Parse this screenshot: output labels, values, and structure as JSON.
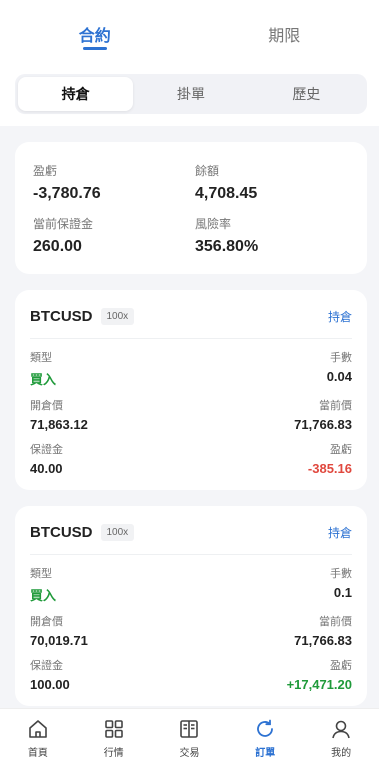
{
  "tabs": [
    {
      "label": "合約",
      "active": true
    },
    {
      "label": "期限",
      "active": false
    }
  ],
  "segments": [
    {
      "label": "持倉",
      "active": true
    },
    {
      "label": "掛單",
      "active": false
    },
    {
      "label": "歷史",
      "active": false
    }
  ],
  "summary": {
    "pnl_label": "盈虧",
    "pnl": "-3,780.76",
    "balance_label": "餘額",
    "balance": "4,708.45",
    "margin_label": "當前保證金",
    "margin": "260.00",
    "risk_label": "風險率",
    "risk": "356.80%"
  },
  "positions": [
    {
      "symbol": "BTCUSD",
      "leverage": "100x",
      "status": "持倉",
      "type_label": "類型",
      "type": "買入",
      "lots_label": "手數",
      "lots": "0.04",
      "open_label": "開倉價",
      "open": "71,863.12",
      "current_label": "當前價",
      "current": "71,766.83",
      "margin_label": "保證金",
      "margin": "40.00",
      "pnl_label": "盈虧",
      "pnl": "-385.16"
    },
    {
      "symbol": "BTCUSD",
      "leverage": "100x",
      "status": "持倉",
      "type_label": "類型",
      "type": "買入",
      "lots_label": "手數",
      "lots": "0.1",
      "open_label": "開倉價",
      "open": "70,019.71",
      "current_label": "當前價",
      "current": "71,766.83",
      "margin_label": "保證金",
      "margin": "100.00",
      "pnl_label": "盈虧",
      "pnl": "+17,471.20"
    }
  ],
  "nav": [
    {
      "label": "首頁",
      "icon": "home-icon"
    },
    {
      "label": "行情",
      "icon": "grid-icon"
    },
    {
      "label": "交易",
      "icon": "book-icon"
    },
    {
      "label": "訂單",
      "icon": "refresh-icon",
      "active": true
    },
    {
      "label": "我的",
      "icon": "user-icon"
    }
  ],
  "colors": {
    "accent": "#2d72d2",
    "positive": "#1f9a3a",
    "negative": "#e0483e"
  }
}
